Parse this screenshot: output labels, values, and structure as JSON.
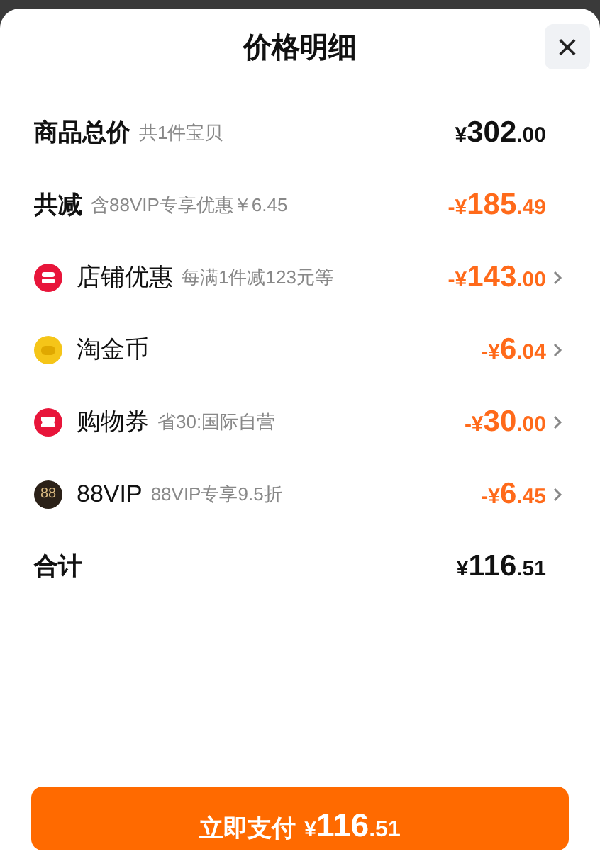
{
  "title": "价格明细",
  "close": "×",
  "rows": [
    {
      "kind": "total",
      "label": "商品总价",
      "note": "共1件宝贝",
      "amount": {
        "sign": "¥",
        "int": "302",
        "dec": ".00"
      }
    },
    {
      "kind": "reduction",
      "label": "共减",
      "note": "含88VIP专享优惠￥6.45",
      "amount": {
        "sign": "-¥",
        "int": "185",
        "dec": ".49"
      }
    },
    {
      "kind": "shop",
      "label": "店铺优惠",
      "note": "每满1件减123元等",
      "amount": {
        "sign": "-¥",
        "int": "143",
        "dec": ".00"
      }
    },
    {
      "kind": "coin",
      "label": "淘金币",
      "amount": {
        "sign": "-¥",
        "int": "6",
        "dec": ".04"
      }
    },
    {
      "kind": "ticket",
      "label": "购物券",
      "note": "省30:国际自营",
      "amount": {
        "sign": "-¥",
        "int": "30",
        "dec": ".00"
      }
    },
    {
      "kind": "vip",
      "badge": "88",
      "label": "88VIP",
      "note": "88VIP专享9.5折",
      "amount": {
        "sign": "-¥",
        "int": "6",
        "dec": ".45"
      }
    },
    {
      "kind": "total",
      "label": "合计",
      "amount": {
        "sign": "¥",
        "int": "116",
        "dec": ".51"
      }
    }
  ],
  "pay_button": {
    "label": "立即支付",
    "amount": {
      "sign": "¥",
      "int": "116",
      "dec": ".51"
    }
  }
}
